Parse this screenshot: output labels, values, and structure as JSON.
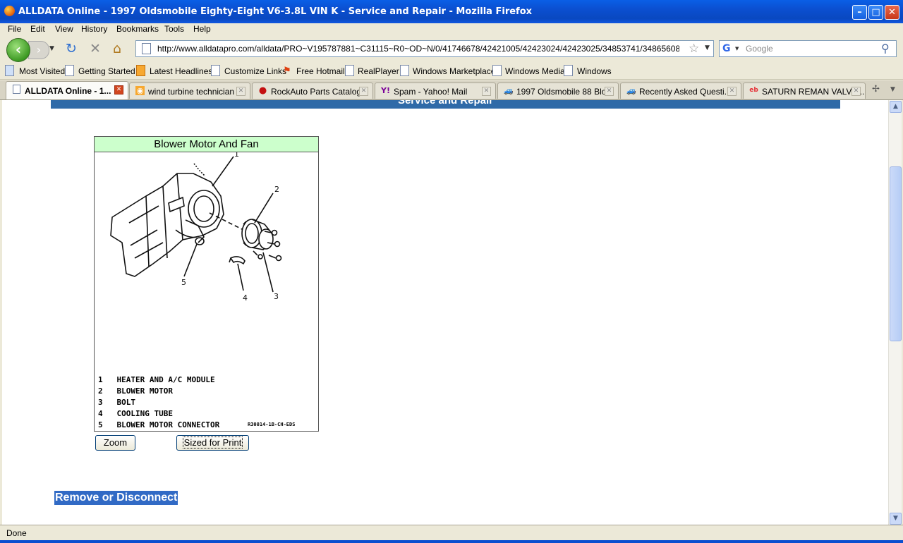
{
  "window": {
    "title": "ALLDATA Online - 1997 Oldsmobile Eighty-Eight V6-3.8L VIN K - Service and Repair - Mozilla Firefox"
  },
  "menu": [
    "File",
    "Edit",
    "View",
    "History",
    "Bookmarks",
    "Tools",
    "Help"
  ],
  "nav": {
    "url": "http://www.alldatapro.com/alldata/PRO~V195787881~C31115~R0~OD~N/0/41746678/42421005/42423024/42423025/34853741/34865608/34865794/3",
    "search_placeholder": "Google"
  },
  "bookmarks": [
    "Most Visited",
    "Getting Started",
    "Latest Headlines",
    "Customize Links",
    "Free Hotmail",
    "RealPlayer",
    "Windows Marketplace",
    "Windows Media",
    "Windows"
  ],
  "tabs": [
    {
      "label": "ALLDATA Online - 1...",
      "active": true
    },
    {
      "label": "wind turbine technician ...",
      "active": false
    },
    {
      "label": "RockAuto Parts Catalog",
      "active": false
    },
    {
      "label": "Spam - Yahoo! Mail",
      "active": false
    },
    {
      "label": "1997 Oldsmobile 88 Blo...",
      "active": false
    },
    {
      "label": "Recently Asked Questi...",
      "active": false
    },
    {
      "label": "SATURN REMAN VALVE...",
      "active": false
    }
  ],
  "page": {
    "header": "Service and Repair",
    "figure_title": "Blower Motor And Fan",
    "callouts": [
      "1",
      "2",
      "3",
      "4",
      "5"
    ],
    "legend": [
      "1   HEATER AND A/C MODULE",
      "2   BLOWER MOTOR",
      "3   BOLT",
      "4   COOLING TUBE",
      "5   BLOWER MOTOR CONNECTOR"
    ],
    "figure_code": "R30014-1B-CH-EDS",
    "zoom_label": "Zoom",
    "print_label": "Sized for Print",
    "section_heading": "Remove or Disconnect"
  },
  "status": {
    "text": "Done"
  }
}
